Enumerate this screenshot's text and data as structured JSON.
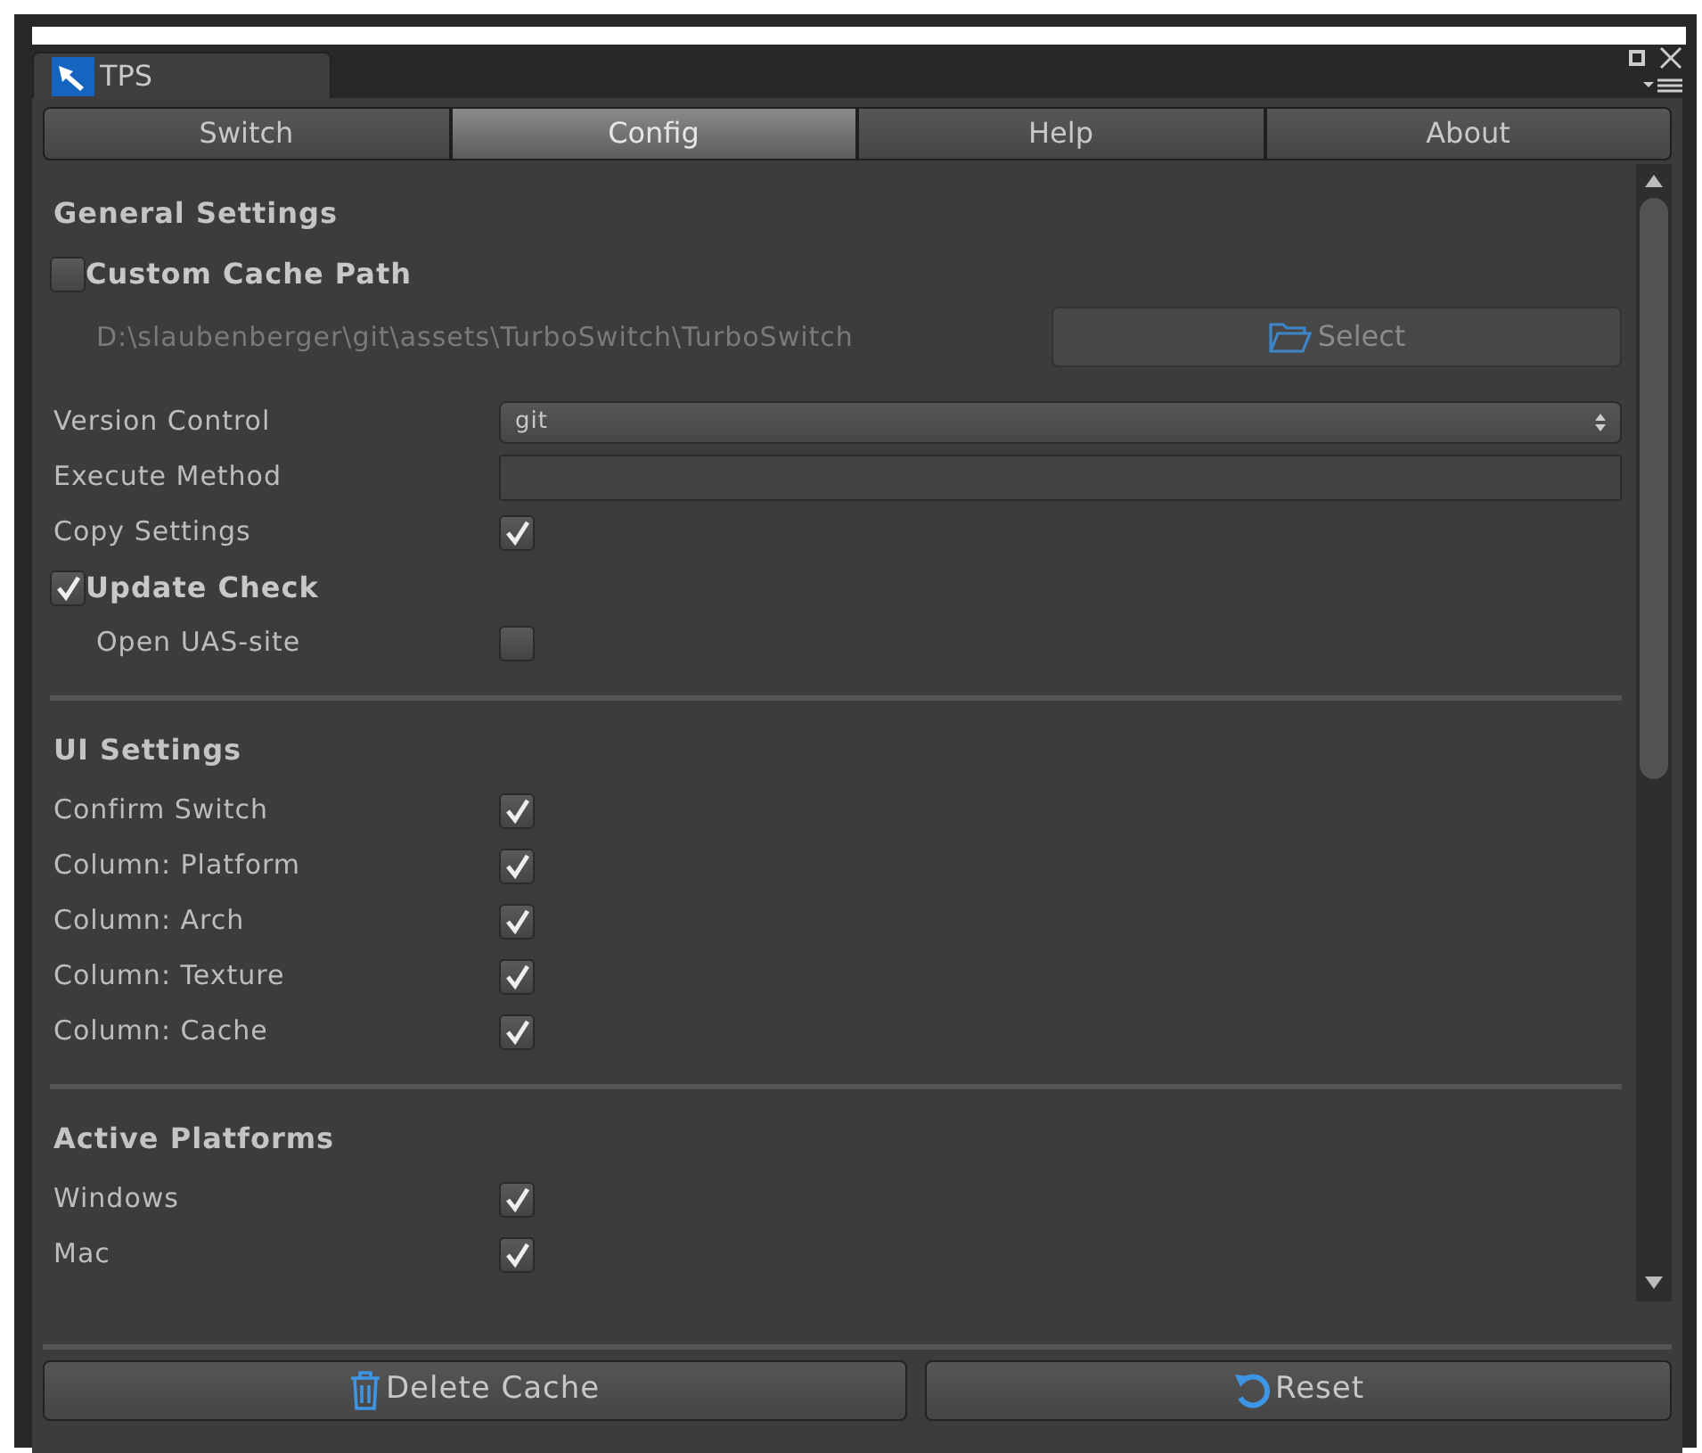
{
  "window": {
    "tab_title": "TPS"
  },
  "tabs": [
    {
      "label": "Switch",
      "selected": false
    },
    {
      "label": "Config",
      "selected": true
    },
    {
      "label": "Help",
      "selected": false
    },
    {
      "label": "About",
      "selected": false
    }
  ],
  "sections": [
    {
      "title": "General Settings",
      "rows": [
        {
          "kind": "heading-check",
          "label": "Custom Cache Path",
          "checked": false
        },
        {
          "kind": "path",
          "value": "D:\\slaubenberger\\git\\assets\\TurboSwitch\\TurboSwitch",
          "button": "Select"
        },
        {
          "kind": "dropdown",
          "label": "Version Control",
          "value": "git"
        },
        {
          "kind": "input",
          "label": "Execute Method"
        },
        {
          "kind": "check",
          "label": "Copy Settings",
          "checked": true
        },
        {
          "kind": "heading-check",
          "label": "Update Check",
          "checked": true
        },
        {
          "kind": "check",
          "label": "Open UAS-site",
          "checked": false,
          "indent": true
        }
      ]
    },
    {
      "title": "UI Settings",
      "rows": [
        {
          "kind": "check",
          "label": "Confirm Switch",
          "checked": true
        },
        {
          "kind": "check",
          "label": "Column: Platform",
          "checked": true
        },
        {
          "kind": "check",
          "label": "Column: Arch",
          "checked": true
        },
        {
          "kind": "check",
          "label": "Column: Texture",
          "checked": true
        },
        {
          "kind": "check",
          "label": "Column: Cache",
          "checked": true
        }
      ]
    },
    {
      "title": "Active Platforms",
      "rows": [
        {
          "kind": "check",
          "label": "Windows",
          "checked": true
        },
        {
          "kind": "check",
          "label": "Mac",
          "checked": true
        }
      ]
    }
  ],
  "buttons": [
    {
      "kind": "delete",
      "label": "Delete Cache"
    },
    {
      "kind": "reset",
      "label": "Reset"
    }
  ]
}
